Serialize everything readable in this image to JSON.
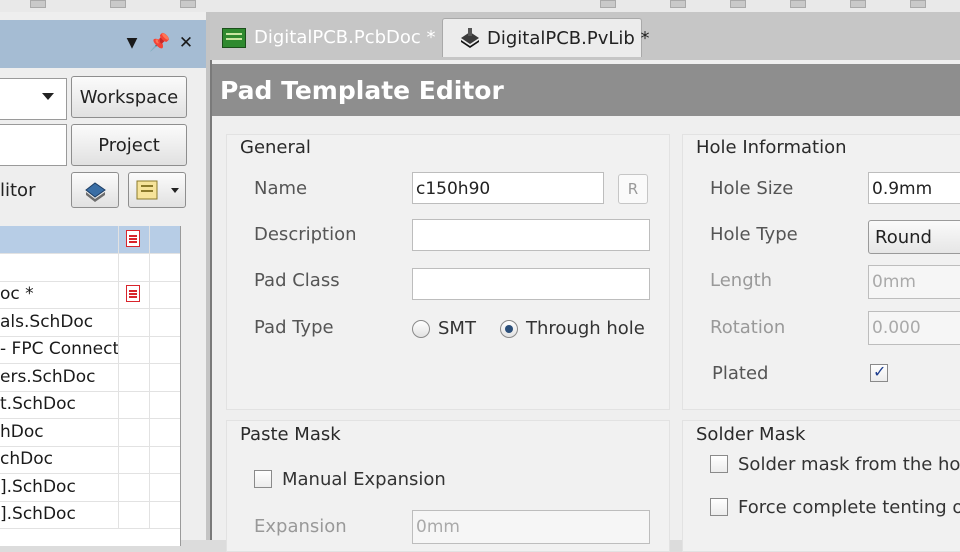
{
  "left_panel": {
    "workspace_button": "Workspace",
    "project_button": "Project",
    "editor_label": "litor",
    "files": [
      {
        "name": "",
        "selected": true,
        "icon": "document-icon"
      },
      {
        "name": "",
        "selected": false,
        "icon": ""
      },
      {
        "name": "oc *",
        "selected": false,
        "icon": "document-icon"
      },
      {
        "name": "als.SchDoc",
        "selected": false,
        "icon": ""
      },
      {
        "name": "- FPC Connect",
        "selected": false,
        "icon": ""
      },
      {
        "name": "ers.SchDoc",
        "selected": false,
        "icon": ""
      },
      {
        "name": "t.SchDoc",
        "selected": false,
        "icon": ""
      },
      {
        "name": "hDoc",
        "selected": false,
        "icon": ""
      },
      {
        "name": "chDoc",
        "selected": false,
        "icon": ""
      },
      {
        "name": "].SchDoc",
        "selected": false,
        "icon": ""
      },
      {
        "name": "].SchDoc",
        "selected": false,
        "icon": ""
      }
    ]
  },
  "tabs": [
    {
      "label": "DigitalPCB.PcbDoc *",
      "active": false,
      "icon": "pcb-icon"
    },
    {
      "label": "DigitalPCB.PvLib *",
      "active": true,
      "icon": "library-icon"
    }
  ],
  "editor": {
    "title": "Pad Template Editor",
    "general": {
      "title": "General",
      "name_label": "Name",
      "name_value": "c150h90",
      "r_button": "R",
      "description_label": "Description",
      "description_value": "",
      "pad_class_label": "Pad Class",
      "pad_class_value": "",
      "pad_type_label": "Pad Type",
      "smt_label": "SMT",
      "through_hole_label": "Through hole",
      "pad_type_selected": "Through hole"
    },
    "hole": {
      "title": "Hole Information",
      "hole_size_label": "Hole Size",
      "hole_size_value": "0.9mm",
      "hole_type_label": "Hole Type",
      "hole_type_value": "Round",
      "length_label": "Length",
      "length_value": "0mm",
      "rotation_label": "Rotation",
      "rotation_value": "0.000",
      "plated_label": "Plated",
      "plated_checked": true
    },
    "paste": {
      "title": "Paste Mask",
      "manual_label": "Manual Expansion",
      "manual_checked": false,
      "expansion_label": "Expansion",
      "expansion_value": "0mm"
    },
    "solder": {
      "title": "Solder Mask",
      "from_hole_label": "Solder mask from the hol",
      "force_tenting_label": "Force complete tenting o"
    }
  }
}
